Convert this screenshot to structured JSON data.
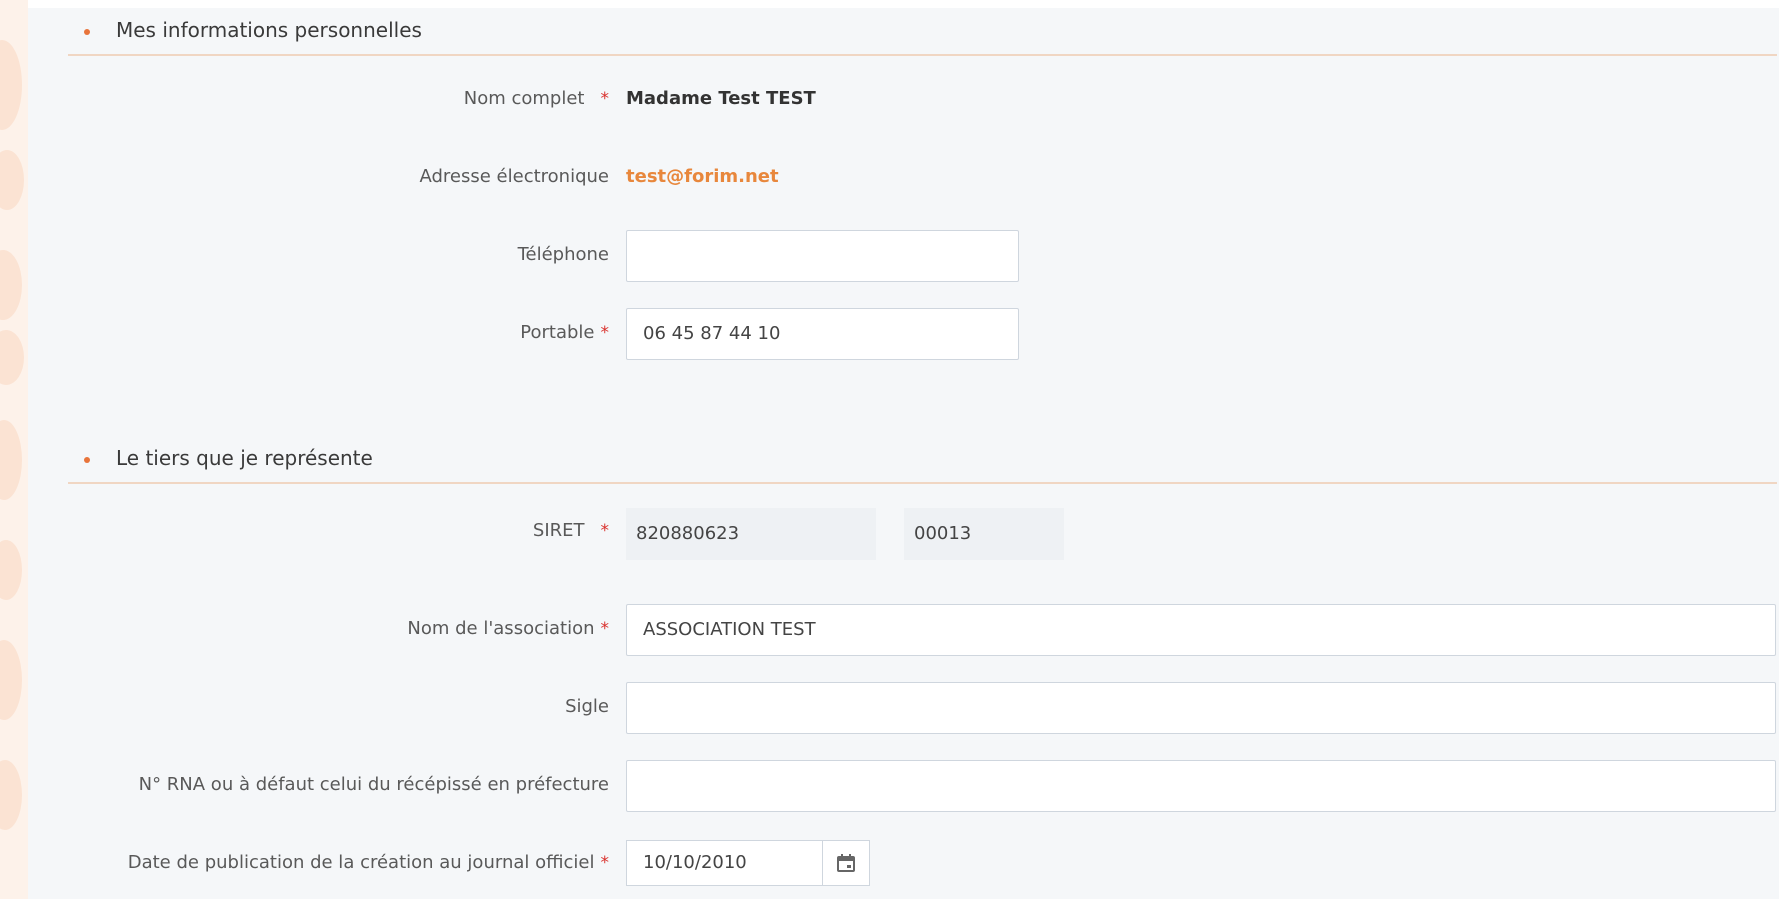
{
  "personal": {
    "title": "Mes informations personnelles",
    "full_name_label": "Nom complet",
    "full_name_value": "Madame Test TEST",
    "email_label": "Adresse électronique",
    "email_value": "test@forim.net",
    "phone_label": "Téléphone",
    "phone_value": "",
    "mobile_label": "Portable",
    "mobile_value": "06 45 87 44 10"
  },
  "organization": {
    "title": "Le tiers que je représente",
    "siret_label": "SIRET",
    "siret_siren": "820880623",
    "siret_nic": "00013",
    "name_label": "Nom de l'association",
    "name_value": "ASSOCIATION TEST",
    "acronym_label": "Sigle",
    "acronym_value": "",
    "rna_label": "N° RNA ou à défaut celui du récépissé en préfecture",
    "rna_value": "",
    "pub_date_label": "Date de publication de la création au journal officiel",
    "pub_date_value": "10/10/2010"
  },
  "required_marker": "*",
  "colors": {
    "accent": "#e8743b",
    "required": "#d9302c",
    "link": "#e8873c",
    "panel_bg": "#f5f7f9"
  },
  "icons": {
    "bullet": "dot-icon",
    "calendar": "calendar-icon"
  }
}
